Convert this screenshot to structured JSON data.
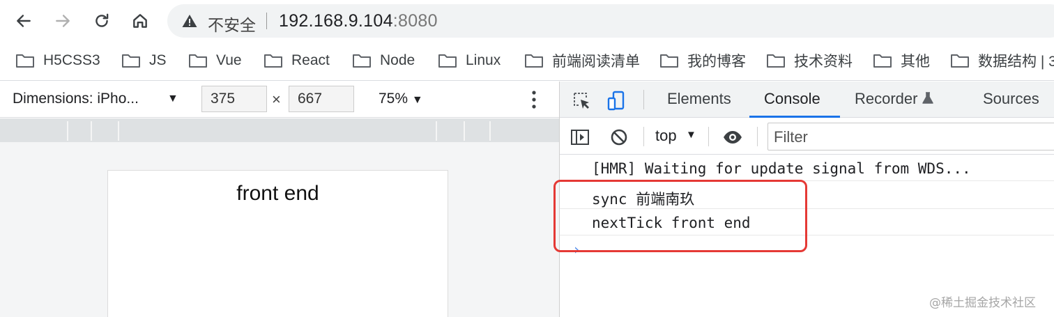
{
  "browser": {
    "security_label": "不安全",
    "url_host": "192.168.9.104",
    "url_port": ":8080"
  },
  "bookmarks": [
    {
      "label": "H5CSS3"
    },
    {
      "label": "JS"
    },
    {
      "label": "Vue"
    },
    {
      "label": "React"
    },
    {
      "label": "Node"
    },
    {
      "label": "Linux"
    },
    {
      "label": "前端阅读清单"
    },
    {
      "label": "我的博客"
    },
    {
      "label": "技术资料"
    },
    {
      "label": "其他"
    },
    {
      "label": "数据结构 | 3"
    }
  ],
  "device_toolbar": {
    "dimensions": "Dimensions: iPho...",
    "width": "375",
    "times": "×",
    "height": "667",
    "zoom": "75%"
  },
  "device_page": {
    "text": "front end"
  },
  "devtools": {
    "tabs": [
      {
        "label": "Elements"
      },
      {
        "label": "Console",
        "active": true
      },
      {
        "label": "Recorder"
      },
      {
        "label": "Sources"
      }
    ],
    "context": "top",
    "filter_placeholder": "Filter"
  },
  "console": {
    "lines": [
      "[HMR] Waiting for update signal from WDS...",
      "sync 前端南玖",
      "nextTick front end"
    ],
    "prompt": "›"
  },
  "watermark": "@稀土掘金技术社区",
  "colors": {
    "accent": "#1a73e8",
    "highlight": "#e53935"
  }
}
